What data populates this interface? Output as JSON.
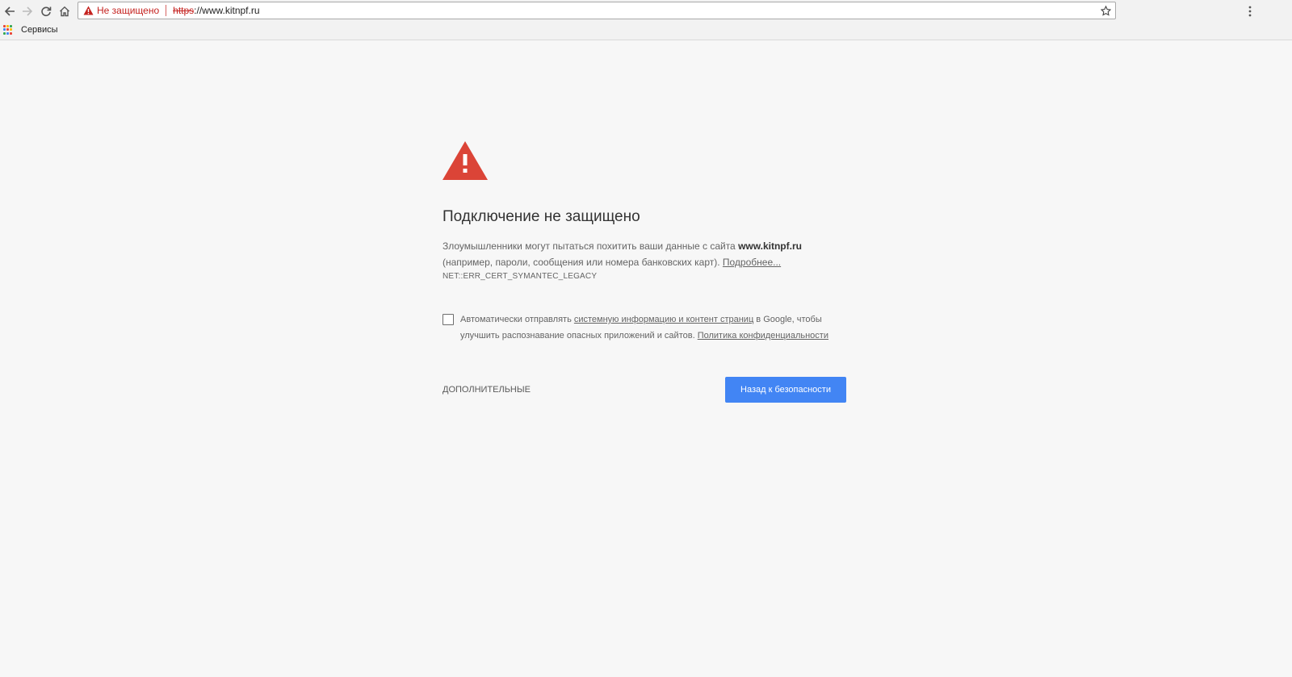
{
  "browser": {
    "security_label": "Не защищено",
    "url_scheme": "https",
    "url_rest": "://www.kitnpf.ru",
    "security_color": "#c5221f",
    "bookmarks": {
      "apps_label": "Сервисы"
    }
  },
  "interstitial": {
    "heading": "Подключение не защищено",
    "message_prefix": "Злоумышленники могут пытаться похитить ваши данные с сайта ",
    "domain": "www.kitnpf.ru",
    "message_suffix": "(например, пароли, сообщения или номера банковских карт). ",
    "learn_more": "Подробнее...",
    "error_code": "NET::ERR_CERT_SYMANTEC_LEGACY",
    "opt_in": {
      "prefix": "Автоматически отправлять ",
      "link1": "системную информацию и контент страниц",
      "middle": " в Google, чтобы улучшить распознавание опасных приложений и сайтов. ",
      "link2": "Политика конфиденциальности"
    },
    "details_label": "ДОПОЛНИТЕЛЬНЫЕ",
    "primary_label": "Назад к безопасности",
    "primary_color": "#4285f4",
    "icon_color": "#db4437"
  }
}
